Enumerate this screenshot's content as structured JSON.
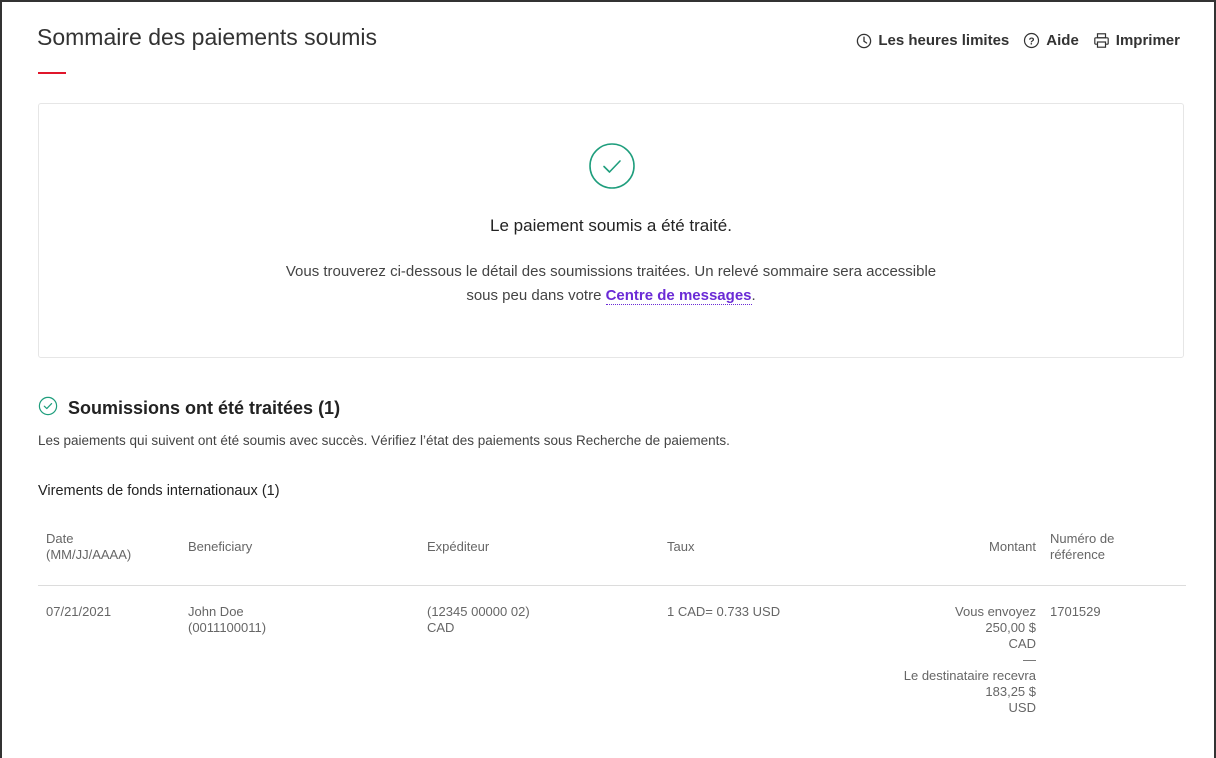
{
  "page": {
    "title": "Sommaire des paiements soumis"
  },
  "toolbar": {
    "cutoff_label": "Les heures limites",
    "help_label": "Aide",
    "print_label": "Imprimer"
  },
  "confirmation": {
    "heading": "Le paiement soumis a été traité.",
    "desc_line1": "Vous trouverez ci-dessous le détail des soumissions traitées. Un relevé sommaire sera accessible",
    "desc_line2_prefix": "sous peu dans votre ",
    "link_label": "Centre de messages",
    "desc_line2_suffix": "."
  },
  "section": {
    "title": "Soumissions ont été traitées (1)",
    "subtitle": "Les paiements qui suivent ont été soumis avec succès. Vérifiez l’état des paiements sous Recherche de paiements.",
    "group_title": "Virements de fonds internationaux (1)"
  },
  "table": {
    "headers": {
      "date_line1": "Date",
      "date_line2": "(MM/JJ/AAAA)",
      "beneficiary": "Beneficiary",
      "sender": "Expéditeur",
      "rate": "Taux",
      "amount": "Montant",
      "reference_line1": "Numéro de",
      "reference_line2": "référence"
    },
    "rows": [
      {
        "date": "07/21/2021",
        "beneficiary_name": "John Doe",
        "beneficiary_account": "(0011100011)",
        "sender_account": "(12345 00000 02)",
        "sender_currency": "CAD",
        "rate": "1 CAD= 0.733 USD",
        "send_label": "Vous envoyez",
        "send_amount": "250,00 $",
        "send_currency": "CAD",
        "separator": "—",
        "receive_label": "Le destinataire recevra",
        "receive_amount": "183,25 $",
        "receive_currency": "USD",
        "reference": "1701529"
      }
    ]
  },
  "colors": {
    "accent_red": "#e0162b",
    "success_green": "#1f9e7d",
    "link_purple": "#6b2bd6"
  },
  "icons": [
    "clock-icon",
    "help-circle-icon",
    "printer-icon",
    "check-circle-icon"
  ]
}
